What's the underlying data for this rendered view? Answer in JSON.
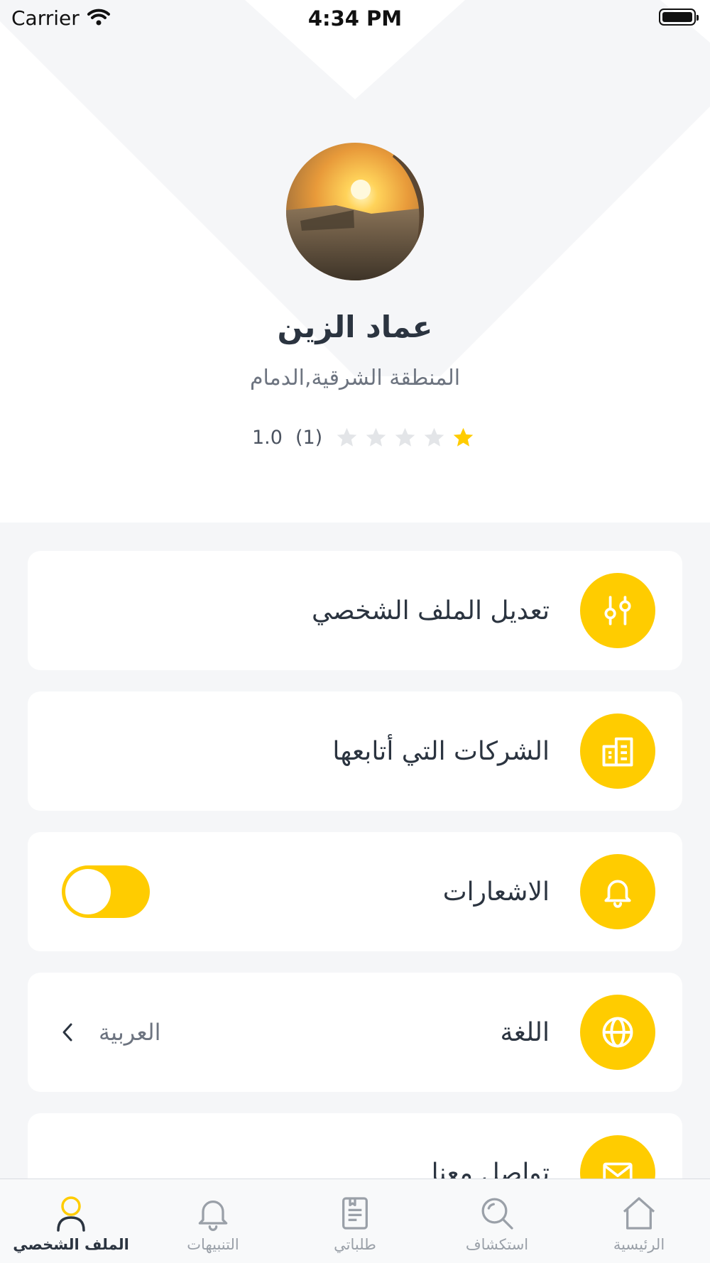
{
  "status_bar": {
    "carrier": "Carrier",
    "time": "4:34 PM"
  },
  "profile": {
    "name": "عماد الزين",
    "location": "المنطقة الشرقية,الدمام",
    "rating_value": "1.0",
    "rating_count": "(1)",
    "rating": 1,
    "rating_max": 5
  },
  "menu": {
    "edit_profile": "تعديل الملف الشخصي",
    "followed_companies": "الشركات التي أتابعها",
    "notifications": "الاشعارات",
    "notifications_enabled": true,
    "language": "اللغة",
    "language_value": "العربية",
    "contact_us": "تواصل معنا"
  },
  "tabbar": {
    "profile": "الملف الشخصي",
    "notifications": "التنبيهات",
    "my_orders": "طلباتي",
    "explore": "استكشاف",
    "home": "الرئيسية"
  },
  "colors": {
    "accent": "#FFCC00",
    "text": "#2B3440",
    "muted": "#9AA0A8",
    "background": "#F5F6F8"
  },
  "icons": {
    "edit_profile": "sliders-icon",
    "followed_companies": "buildings-icon",
    "notifications": "bell-icon",
    "language": "globe-icon",
    "contact_us": "envelope-icon"
  }
}
